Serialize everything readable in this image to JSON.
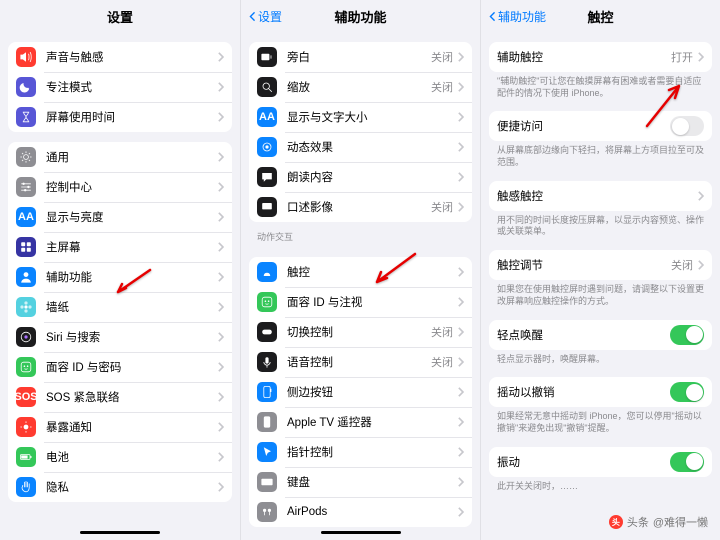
{
  "col1": {
    "title": "设置",
    "groups": [
      {
        "rows": [
          {
            "icon": "speaker",
            "bg": "#ff3b30",
            "label": "声音与触感"
          },
          {
            "icon": "moon",
            "bg": "#5856d6",
            "label": "专注模式"
          },
          {
            "icon": "hourglass",
            "bg": "#5856d6",
            "label": "屏幕使用时间"
          }
        ]
      },
      {
        "rows": [
          {
            "icon": "gear",
            "bg": "#8e8e93",
            "label": "通用"
          },
          {
            "icon": "sliders",
            "bg": "#8e8e93",
            "label": "控制中心"
          },
          {
            "icon": "AA",
            "bg": "#0a84ff",
            "label": "显示与亮度"
          },
          {
            "icon": "grid",
            "bg": "#3634a3",
            "label": "主屏幕"
          },
          {
            "icon": "person",
            "bg": "#0a84ff",
            "label": "辅助功能"
          },
          {
            "icon": "flower",
            "bg": "#54d1e0",
            "label": "墙纸"
          },
          {
            "icon": "siri",
            "bg": "#1c1c1e",
            "label": "Siri 与搜索"
          },
          {
            "icon": "face",
            "bg": "#34c759",
            "label": "面容 ID 与密码"
          },
          {
            "icon": "SOS",
            "bg": "#ff3b30",
            "label": "SOS 紧急联络"
          },
          {
            "icon": "sun",
            "bg": "#ff3b30",
            "label": "暴露通知"
          },
          {
            "icon": "battery",
            "bg": "#34c759",
            "label": "电池"
          },
          {
            "icon": "hand",
            "bg": "#0a84ff",
            "label": "隐私"
          }
        ]
      }
    ]
  },
  "col2": {
    "title": "辅助功能",
    "back": "设置",
    "groups": [
      {
        "rows": [
          {
            "icon": "vo",
            "bg": "#1c1c1e",
            "label": "旁白",
            "value": "关闭"
          },
          {
            "icon": "zoom",
            "bg": "#1c1c1e",
            "label": "缩放",
            "value": "关闭"
          },
          {
            "icon": "AA",
            "bg": "#0a84ff",
            "label": "显示与文字大小"
          },
          {
            "icon": "motion",
            "bg": "#0a84ff",
            "label": "动态效果"
          },
          {
            "icon": "bubble",
            "bg": "#1c1c1e",
            "label": "朗读内容"
          },
          {
            "icon": "desc",
            "bg": "#1c1c1e",
            "label": "口述影像",
            "value": "关闭"
          }
        ]
      },
      {
        "section": "动作交互",
        "rows": [
          {
            "icon": "touch",
            "bg": "#0a84ff",
            "label": "触控"
          },
          {
            "icon": "face",
            "bg": "#34c759",
            "label": "面容 ID 与注视"
          },
          {
            "icon": "switch",
            "bg": "#1c1c1e",
            "label": "切换控制",
            "value": "关闭"
          },
          {
            "icon": "mic",
            "bg": "#1c1c1e",
            "label": "语音控制",
            "value": "关闭"
          },
          {
            "icon": "side",
            "bg": "#0a84ff",
            "label": "侧边按钮"
          },
          {
            "icon": "tv",
            "bg": "#8e8e93",
            "label": "Apple TV 遥控器"
          },
          {
            "icon": "pointer",
            "bg": "#0a84ff",
            "label": "指针控制"
          },
          {
            "icon": "kb",
            "bg": "#8e8e93",
            "label": "键盘"
          },
          {
            "icon": "airpods",
            "bg": "#8e8e93",
            "label": "AirPods"
          }
        ]
      }
    ]
  },
  "col3": {
    "title": "触控",
    "back": "辅助功能",
    "blocks": [
      {
        "type": "grp",
        "rows": [
          {
            "label": "辅助触控",
            "value": "打开"
          }
        ]
      },
      {
        "type": "note",
        "text": "\"辅助触控\"可让您在触摸屏幕有困难或者需要自适应配件的情况下使用 iPhone。"
      },
      {
        "type": "grp",
        "rows": [
          {
            "label": "便捷访问",
            "toggle": "off"
          }
        ]
      },
      {
        "type": "note",
        "text": "从屏幕底部边缘向下轻扫，将屏幕上方项目拉至可及范围。"
      },
      {
        "type": "grp",
        "rows": [
          {
            "label": "触感触控"
          }
        ]
      },
      {
        "type": "note",
        "text": "用不同的时间长度按压屏幕，以显示内容预览、操作或关联菜单。"
      },
      {
        "type": "grp",
        "rows": [
          {
            "label": "触控调节",
            "value": "关闭"
          }
        ]
      },
      {
        "type": "note",
        "text": "如果您在使用触控屏时遇到问题，请调整以下设置更改屏幕响应触控操作的方式。"
      },
      {
        "type": "grp",
        "rows": [
          {
            "label": "轻点唤醒",
            "toggle": "on"
          }
        ]
      },
      {
        "type": "note",
        "text": "轻点显示器时，唤醒屏幕。"
      },
      {
        "type": "grp",
        "rows": [
          {
            "label": "摇动以撤销",
            "toggle": "on"
          }
        ]
      },
      {
        "type": "note",
        "text": "如果经常无意中摇动到 iPhone，您可以停用\"摇动以撤销\"来避免出现\"撤销\"提醒。"
      },
      {
        "type": "grp",
        "rows": [
          {
            "label": "振动",
            "toggle": "on"
          }
        ]
      },
      {
        "type": "note",
        "text": "此开关关闭时，……"
      }
    ]
  },
  "watermark": {
    "prefix": "头条",
    "author": "@难得一懒"
  }
}
